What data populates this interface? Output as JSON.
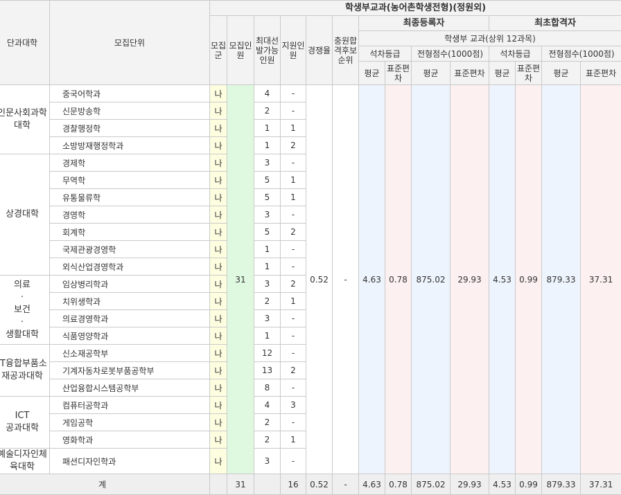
{
  "header": {
    "main_title": "학생부교과(농어촌학생전형)(정원외)",
    "college": "단과대학",
    "unit": "모집단위",
    "group": "모집군",
    "recruit": "모집인원",
    "max_select": "최대선발가능인원",
    "applicants": "지원인원",
    "competition": "경쟁율",
    "reserve_rank": "충원합격후보순위",
    "final_registrants": "최종등록자",
    "first_admits": "최초합격자",
    "subject_basis": "학생부 교과(상위 12과목)",
    "grade": "석차등급",
    "score": "전형점수(1000점)",
    "avg": "평균",
    "sd": "표준편차"
  },
  "merged": {
    "recruit_total": "31",
    "competition": "0.52",
    "reserve_rank": "-",
    "final_grade_avg": "4.63",
    "final_grade_sd": "0.78",
    "final_score_avg": "875.02",
    "final_score_sd": "29.93",
    "first_grade_avg": "4.53",
    "first_grade_sd": "0.99",
    "first_score_avg": "879.33",
    "first_score_sd": "37.31"
  },
  "colleges": [
    {
      "name": "인문사회과학대학",
      "units": [
        {
          "unit": "중국어학과",
          "group": "나",
          "max": "4",
          "applied": "-"
        },
        {
          "unit": "신문방송학",
          "group": "나",
          "max": "2",
          "applied": "-"
        },
        {
          "unit": "경찰행정학",
          "group": "나",
          "max": "1",
          "applied": "1"
        },
        {
          "unit": "소방방재행정학과",
          "group": "나",
          "max": "1",
          "applied": "2"
        }
      ]
    },
    {
      "name": "상경대학",
      "units": [
        {
          "unit": "경제학",
          "group": "나",
          "max": "3",
          "applied": "-"
        },
        {
          "unit": "무역학",
          "group": "나",
          "max": "5",
          "applied": "1"
        },
        {
          "unit": "유통물류학",
          "group": "나",
          "max": "5",
          "applied": "1"
        },
        {
          "unit": "경영학",
          "group": "나",
          "max": "3",
          "applied": "-"
        },
        {
          "unit": "회계학",
          "group": "나",
          "max": "5",
          "applied": "2"
        },
        {
          "unit": "국제관광경영학",
          "group": "나",
          "max": "1",
          "applied": "-"
        },
        {
          "unit": "외식산업경영학과",
          "group": "나",
          "max": "1",
          "applied": "-"
        }
      ]
    },
    {
      "name": "의료\n·\n보건\n·\n생활대학",
      "units": [
        {
          "unit": "임상병리학과",
          "group": "나",
          "max": "3",
          "applied": "2"
        },
        {
          "unit": "치위생학과",
          "group": "나",
          "max": "2",
          "applied": "1"
        },
        {
          "unit": "의료경영학과",
          "group": "나",
          "max": "3",
          "applied": "-"
        },
        {
          "unit": "식품영양학과",
          "group": "나",
          "max": "1",
          "applied": "-"
        }
      ]
    },
    {
      "name": "IT융합부품소재공과대학",
      "units": [
        {
          "unit": "신소재공학부",
          "group": "나",
          "max": "12",
          "applied": "-"
        },
        {
          "unit": "기계자동차로봇부품공학부",
          "group": "나",
          "max": "13",
          "applied": "2"
        },
        {
          "unit": "산업융합시스템공학부",
          "group": "나",
          "max": "8",
          "applied": "-"
        }
      ]
    },
    {
      "name": "ICT\n공과대학",
      "units": [
        {
          "unit": "컴퓨터공학과",
          "group": "나",
          "max": "4",
          "applied": "3"
        },
        {
          "unit": "게임공학",
          "group": "나",
          "max": "2",
          "applied": "-"
        },
        {
          "unit": "영화학과",
          "group": "나",
          "max": "2",
          "applied": "1"
        }
      ]
    },
    {
      "name": "예술디자인체육대학",
      "units": [
        {
          "unit": "패션디자인학과",
          "group": "나",
          "max": "3",
          "applied": "-"
        }
      ]
    }
  ],
  "total": {
    "label": "계",
    "recruit": "31",
    "max": "",
    "applied": "16",
    "competition": "0.52",
    "reserve_rank": "-",
    "final_grade_avg": "4.63",
    "final_grade_sd": "0.78",
    "final_score_avg": "875.02",
    "final_score_sd": "29.93",
    "first_grade_avg": "4.53",
    "first_grade_sd": "0.99",
    "first_score_avg": "879.33",
    "first_score_sd": "37.31"
  },
  "colors": {
    "header_bg": "#f3f3f3",
    "group_col_bg": "#fdfde0",
    "recruit_col_bg": "#dff9e0",
    "avg_col_bg": "#eef4fd",
    "sd_col_bg": "#fcf0f0",
    "total_row_bg": "#efefef"
  }
}
